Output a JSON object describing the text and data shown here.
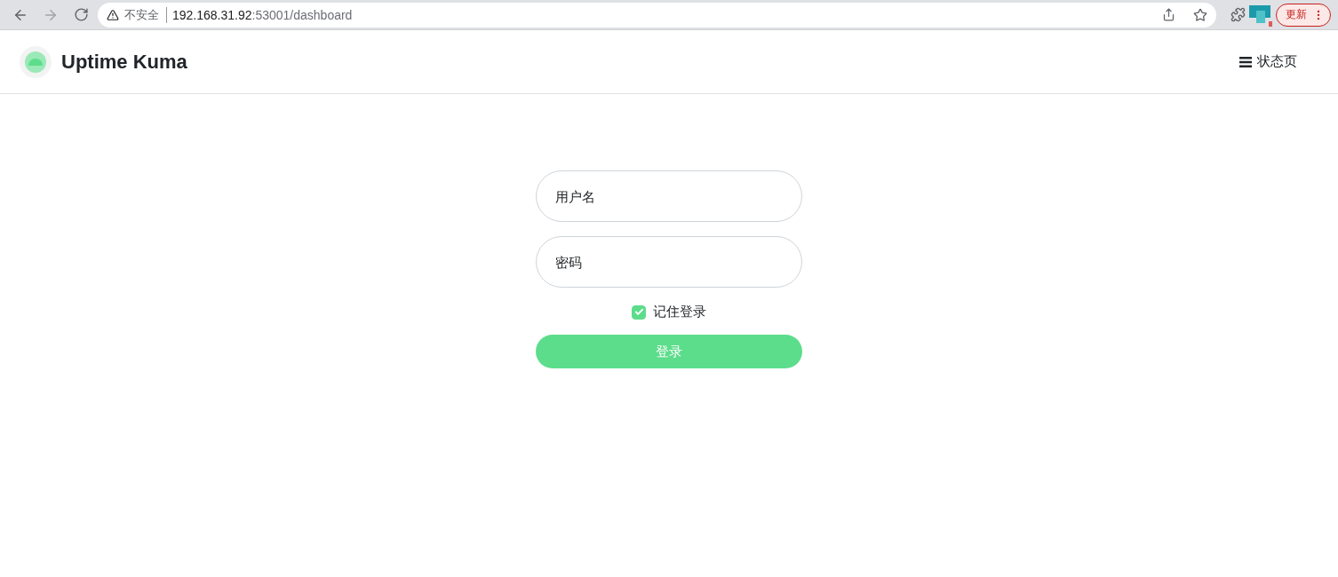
{
  "browser": {
    "security_label": "不安全",
    "url_host": "192.168.31.92",
    "url_path": ":53001/dashboard",
    "update_button": "更新"
  },
  "header": {
    "brand": "Uptime Kuma",
    "nav_link": "状态页"
  },
  "login": {
    "username": {
      "placeholder": "用户名"
    },
    "password": {
      "placeholder": "密码"
    },
    "remember": {
      "label": "记住登录",
      "checked": true
    },
    "submit": "登录"
  }
}
